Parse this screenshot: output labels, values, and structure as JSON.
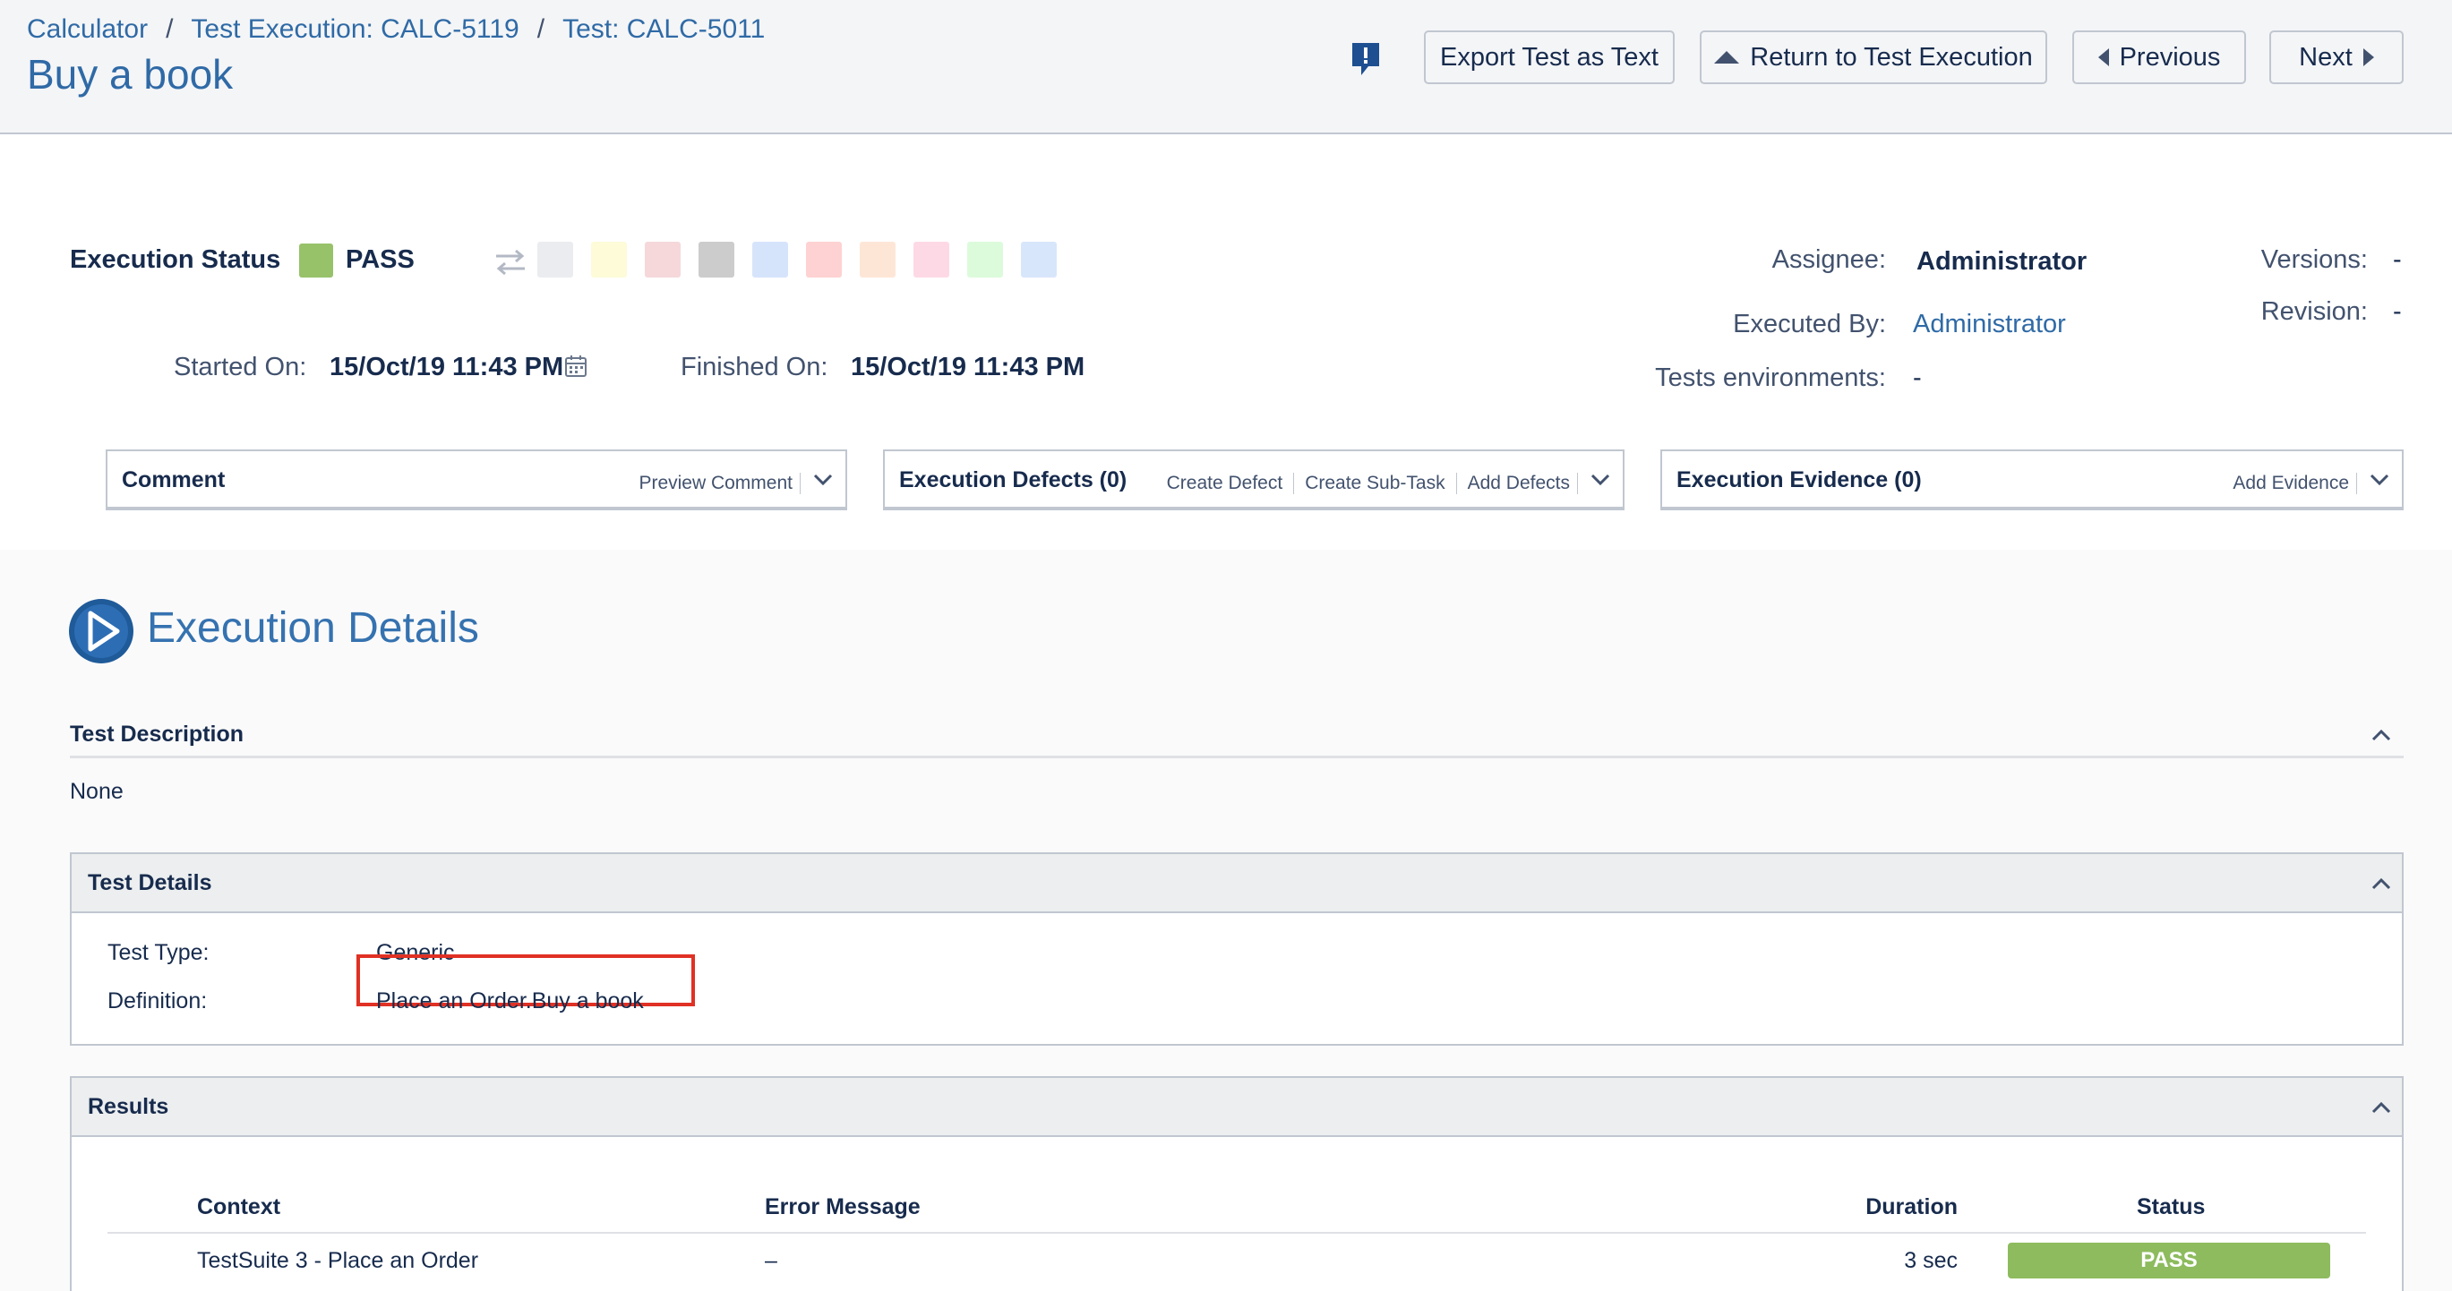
{
  "breadcrumbs": [
    {
      "label": "Calculator"
    },
    {
      "label": "Test Execution: CALC-5119"
    },
    {
      "label": "Test: CALC-5011"
    }
  ],
  "breadcrumb_separator": "/",
  "page_title": "Buy a book",
  "header_buttons": {
    "export": "Export Test as Text",
    "return": "Return to Test Execution",
    "previous": "Previous",
    "next": "Next"
  },
  "execution_status": {
    "label": "Execution Status",
    "value": "PASS",
    "color": "#97c26a",
    "palette": [
      "#ebecf0",
      "#fdfbd8",
      "#f6d8da",
      "#cccccc",
      "#d6e4fb",
      "#fed2d2",
      "#fee6d6",
      "#fdd9e5",
      "#dcfbdb",
      "#d8e6fb"
    ]
  },
  "dates": {
    "started_label": "Started On:",
    "started_value": "15/Oct/19 11:43 PM",
    "finished_label": "Finished On:",
    "finished_value": "15/Oct/19 11:43 PM"
  },
  "people": {
    "assignee_label": "Assignee:",
    "assignee_value": "Administrator",
    "executed_by_label": "Executed By:",
    "executed_by_value": "Administrator",
    "environments_label": "Tests environments:",
    "environments_value": "-",
    "versions_label": "Versions:",
    "versions_value": "-",
    "revision_label": "Revision:",
    "revision_value": "-"
  },
  "panels": {
    "comment": {
      "title": "Comment",
      "actions": [
        "Preview Comment"
      ]
    },
    "defects": {
      "title": "Execution Defects (0)",
      "actions": [
        "Create Defect",
        "Create Sub-Task",
        "Add Defects"
      ]
    },
    "evidence": {
      "title": "Execution Evidence (0)",
      "actions": [
        "Add Evidence"
      ]
    }
  },
  "execution_details": {
    "title": "Execution Details",
    "test_description_title": "Test Description",
    "test_description_value": "None",
    "test_details": {
      "title": "Test Details",
      "type_label": "Test Type:",
      "type_value": "Generic",
      "definition_label": "Definition:",
      "definition_value": "Place an Order.Buy a book"
    },
    "results": {
      "title": "Results",
      "columns": {
        "context": "Context",
        "error": "Error Message",
        "duration": "Duration",
        "status": "Status"
      },
      "rows": [
        {
          "context": "TestSuite 3 - Place an Order",
          "error": "–",
          "duration": "3 sec",
          "status": "PASS",
          "status_color": "#8dbb5e"
        }
      ]
    }
  }
}
